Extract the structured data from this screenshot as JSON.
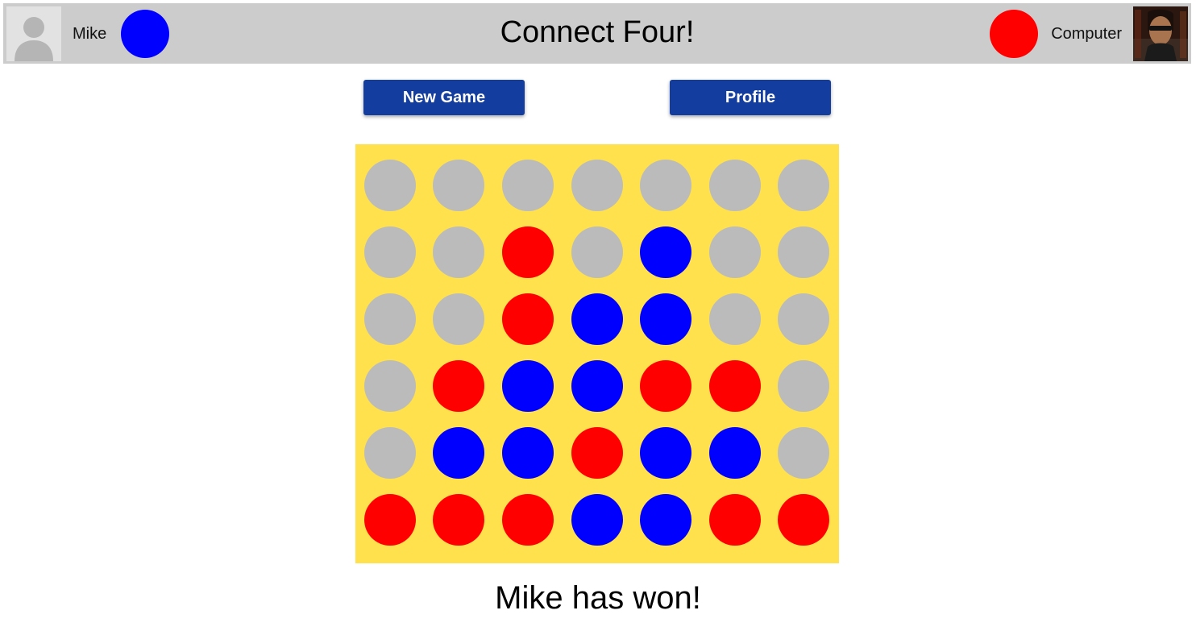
{
  "header": {
    "title": "Connect Four!",
    "player1": {
      "name": "Mike",
      "avatar": "default-user-avatar",
      "color": "#0000ff"
    },
    "player2": {
      "name": "Computer",
      "avatar": "terminator-photo-avatar",
      "color": "#ff0000"
    },
    "background": "#cccccc"
  },
  "buttons": {
    "new_game_label": "New Game",
    "profile_label": "Profile",
    "color": "#133d9e"
  },
  "board": {
    "background": "#ffe04d",
    "columns": 7,
    "rows": 6,
    "colors": {
      "empty": "#bbbbbb",
      "R": "#ff0000",
      "B": "#0000ff"
    },
    "grid": [
      [
        "empty",
        "empty",
        "empty",
        "empty",
        "empty",
        "empty",
        "empty"
      ],
      [
        "empty",
        "empty",
        "R",
        "empty",
        "B",
        "empty",
        "empty"
      ],
      [
        "empty",
        "empty",
        "R",
        "B",
        "B",
        "empty",
        "empty"
      ],
      [
        "empty",
        "R",
        "B",
        "B",
        "R",
        "R",
        "empty"
      ],
      [
        "empty",
        "B",
        "B",
        "R",
        "B",
        "B",
        "empty"
      ],
      [
        "R",
        "R",
        "R",
        "B",
        "B",
        "R",
        "R"
      ]
    ]
  },
  "status": "Mike has won!"
}
